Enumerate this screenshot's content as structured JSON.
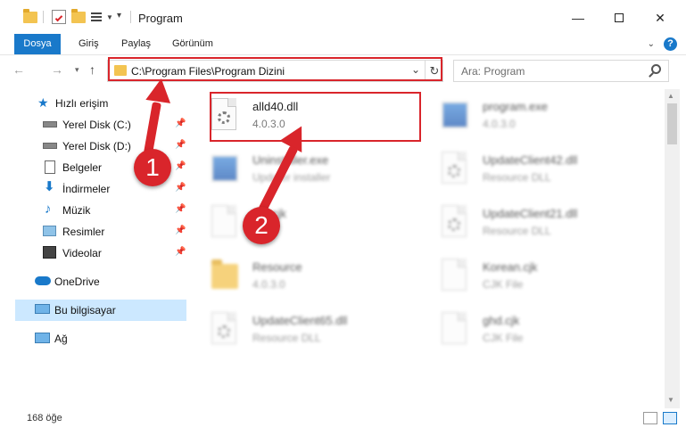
{
  "window": {
    "title": "Program"
  },
  "ribbon": {
    "tabs": [
      "Dosya",
      "Giriş",
      "Paylaş",
      "Görünüm"
    ]
  },
  "address": {
    "path": "C:\\Program Files\\Program Dizini"
  },
  "search": {
    "placeholder": "Ara: Program"
  },
  "sidebar": {
    "items": [
      {
        "label": "Hızlı erişim",
        "icon": "star-icon"
      },
      {
        "label": "Yerel Disk (C:)",
        "icon": "drive-icon"
      },
      {
        "label": "Yerel Disk (D:)",
        "icon": "drive-icon"
      },
      {
        "label": "Belgeler",
        "icon": "documents-icon"
      },
      {
        "label": "İndirmeler",
        "icon": "download-icon"
      },
      {
        "label": "Müzik",
        "icon": "music-icon"
      },
      {
        "label": "Resimler",
        "icon": "pictures-icon"
      },
      {
        "label": "Videolar",
        "icon": "video-icon"
      },
      {
        "label": "OneDrive",
        "icon": "cloud-icon"
      },
      {
        "label": "Bu bilgisayar",
        "icon": "computer-icon"
      },
      {
        "label": "Ağ",
        "icon": "network-icon"
      }
    ]
  },
  "files": [
    {
      "name": "alld40.dll",
      "sub": "4.0.3.0"
    },
    {
      "name": "program.exe",
      "sub": "4.0.3.0"
    },
    {
      "name": "Uninstaller.exe",
      "sub": "Updater installer"
    },
    {
      "name": "UpdateClient42.dll",
      "sub": "Resource DLL"
    },
    {
      "name": "cjk",
      "sub": ""
    },
    {
      "name": "UpdateClient21.dll",
      "sub": "Resource DLL"
    },
    {
      "name": "Resource",
      "sub": "4.0.3.0"
    },
    {
      "name": "Korean.cjk",
      "sub": "CJK File"
    },
    {
      "name": "UpdateClient65.dll",
      "sub": "Resource DLL"
    },
    {
      "name": "ghd.cjk",
      "sub": "CJK File"
    }
  ],
  "status": {
    "count": "168 öğe"
  },
  "callouts": {
    "one": "1",
    "two": "2"
  },
  "colors": {
    "accent": "#1979ca",
    "highlight": "#d9252b"
  }
}
